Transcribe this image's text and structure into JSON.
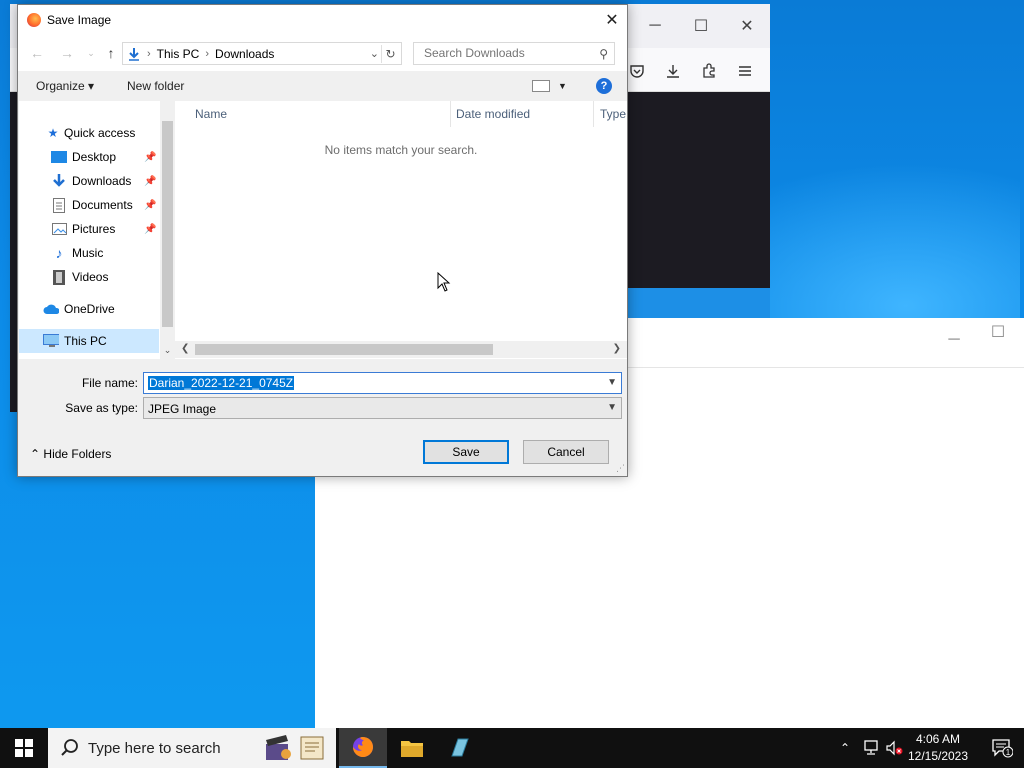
{
  "dialog": {
    "title": "Save Image",
    "close_label": "✕",
    "address": {
      "crumbs": [
        "This PC",
        "Downloads"
      ]
    },
    "search": {
      "placeholder": "Search Downloads"
    },
    "commands": {
      "organize": "Organize",
      "new_folder": "New folder"
    },
    "nav": [
      {
        "label": "Quick access",
        "icon": "star-icon"
      },
      {
        "label": "Desktop",
        "icon": "desktop-folder-icon",
        "pinned": true
      },
      {
        "label": "Downloads",
        "icon": "download-arrow-icon",
        "pinned": true
      },
      {
        "label": "Documents",
        "icon": "document-icon",
        "pinned": true
      },
      {
        "label": "Pictures",
        "icon": "picture-icon",
        "pinned": true
      },
      {
        "label": "Music",
        "icon": "music-note-icon"
      },
      {
        "label": "Videos",
        "icon": "film-icon"
      },
      {
        "label": "OneDrive",
        "icon": "cloud-icon"
      },
      {
        "label": "This PC",
        "icon": "computer-icon",
        "selected": true
      }
    ],
    "columns": [
      "Name",
      "Date modified",
      "Type"
    ],
    "empty_message": "No items match your search.",
    "file_name_label": "File name:",
    "file_name_value": "Darian_2022-12-21_0745Z",
    "save_type_label": "Save as type:",
    "save_type_value": "JPEG Image",
    "hide_folders": "Hide Folders",
    "save_button": "Save",
    "cancel_button": "Cancel"
  },
  "taskbar": {
    "search_placeholder": "Type here to search",
    "time": "4:06 AM",
    "date": "12/15/2023",
    "notification_count": "1"
  },
  "colors": {
    "accent": "#0078d7",
    "desktop": "#0a7bd6",
    "taskbar": "#101010"
  }
}
